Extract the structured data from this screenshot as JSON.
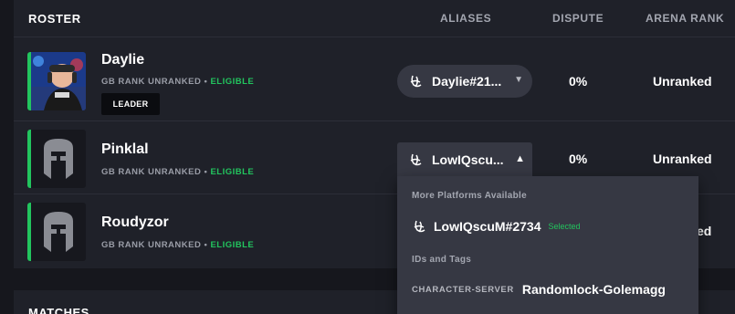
{
  "roster": {
    "title": "ROSTER",
    "columns": {
      "aliases": "ALIASES",
      "dispute": "DISPUTE",
      "arena_rank": "ARENA RANK"
    },
    "players": [
      {
        "name": "Daylie",
        "gb_rank": "GB RANK UNRANKED",
        "separator": "•",
        "status": "ELIGIBLE",
        "badge": "LEADER",
        "alias": "Daylie#21...",
        "dispute": "0%",
        "arena_rank": "Unranked",
        "avatar": "player-photo"
      },
      {
        "name": "Pinklal",
        "gb_rank": "GB RANK UNRANKED",
        "separator": "•",
        "status": "ELIGIBLE",
        "alias": "LowIQscu...",
        "dispute": "0%",
        "arena_rank": "Unranked",
        "avatar": "helmet-icon"
      },
      {
        "name": "Roudyzor",
        "gb_rank": "GB RANK UNRANKED",
        "separator": "•",
        "status": "ELIGIBLE",
        "arena_rank_partial": "ed",
        "avatar": "helmet-icon"
      }
    ]
  },
  "alias_dropdown": {
    "section_platforms": "More Platforms Available",
    "platform_alias": "LowIQscuM#2734",
    "selected_label": "Selected",
    "section_ids": "IDs and Tags",
    "character_label": "CHARACTER-SERVER",
    "character_value": "Randomlock-Golemagg"
  },
  "matches": {
    "title": "MATCHES"
  },
  "colors": {
    "eligible": "#22c55e",
    "panel": "#1f2129",
    "pill": "#363843",
    "background": "#16171d"
  }
}
